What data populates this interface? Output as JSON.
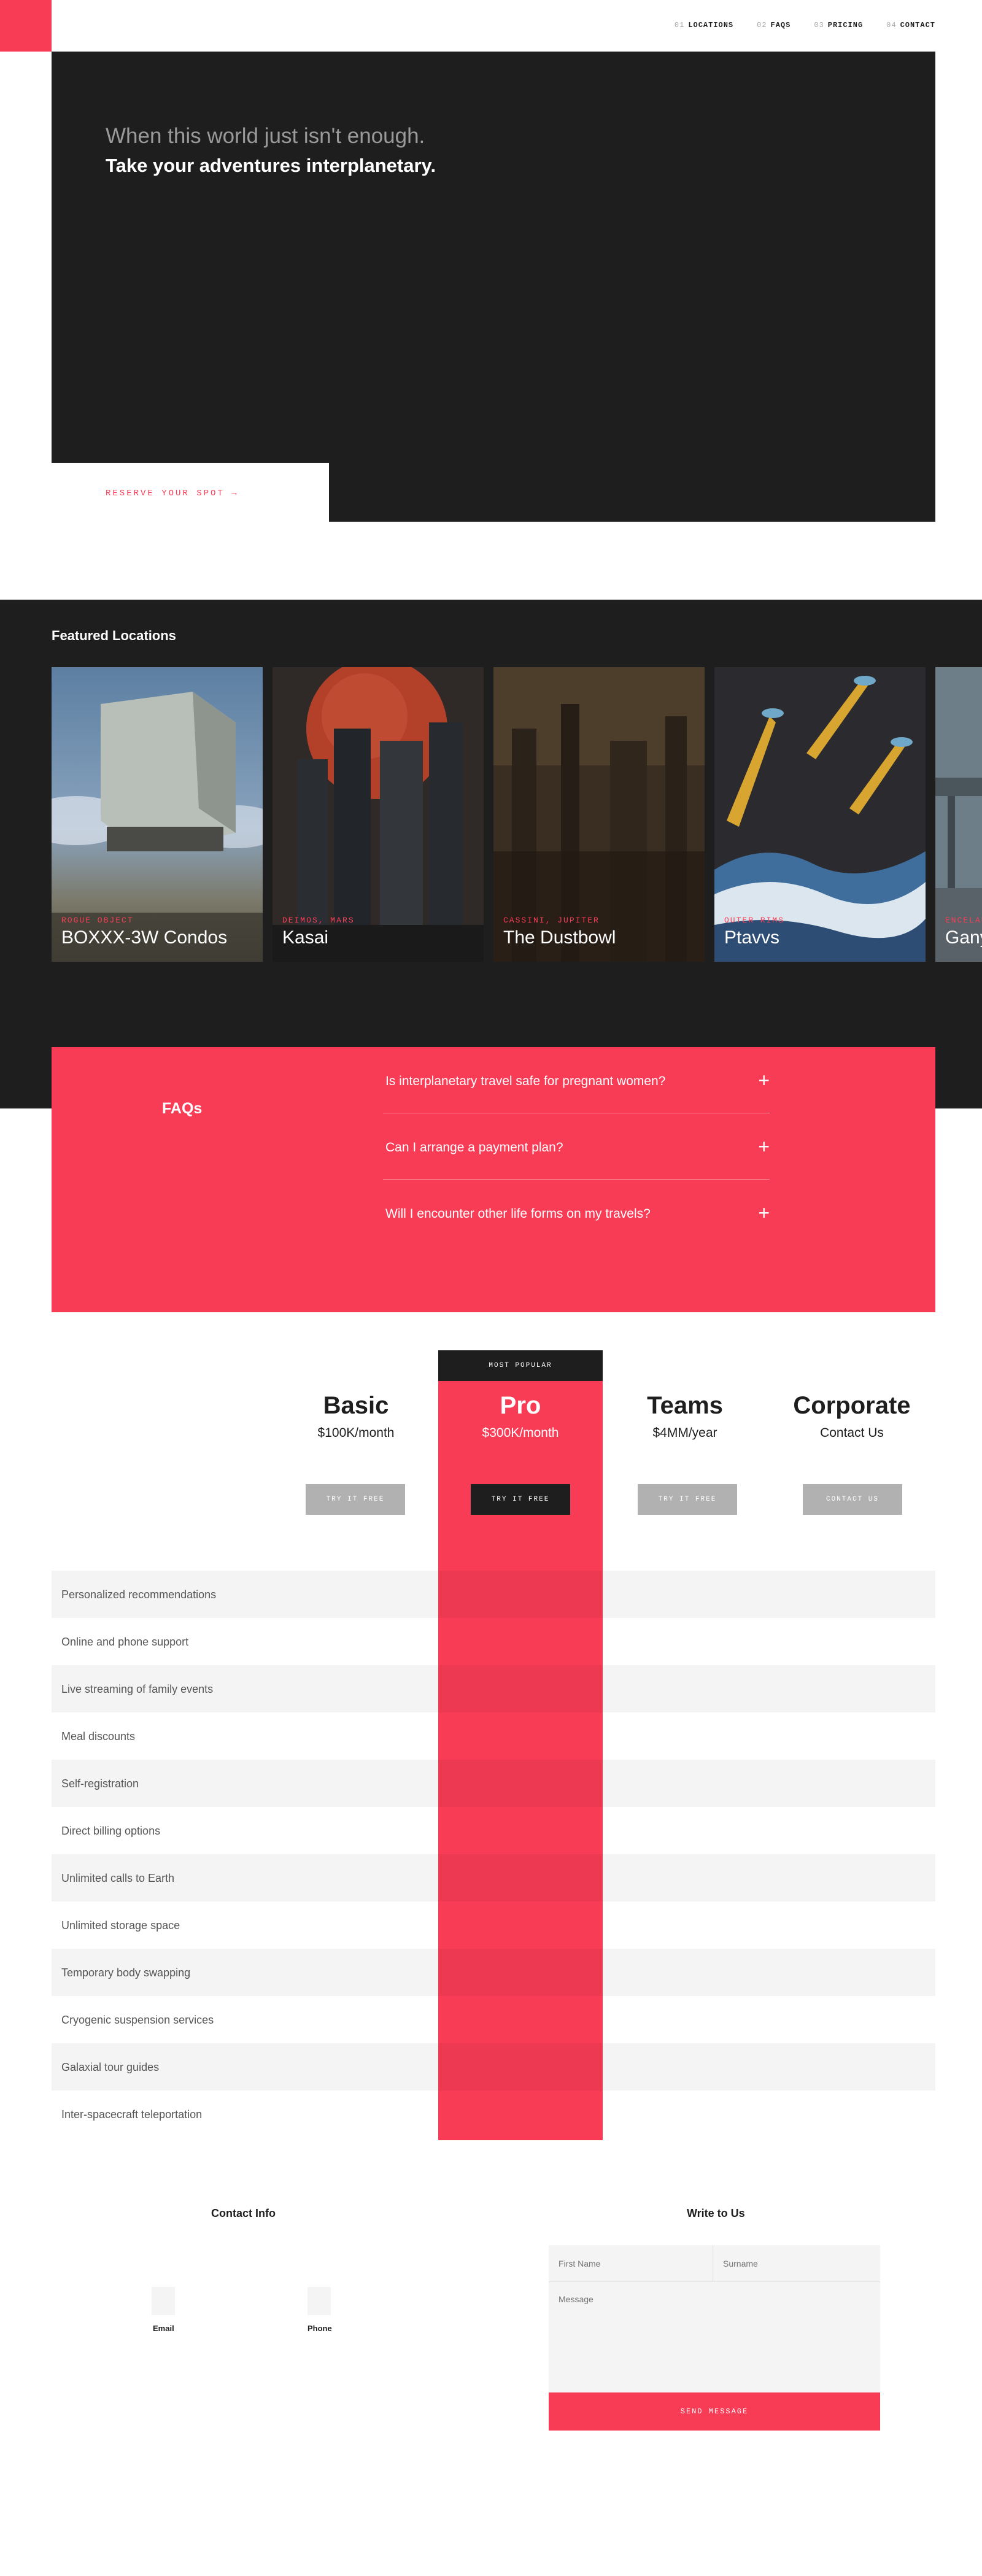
{
  "nav": {
    "items": [
      {
        "num": "01",
        "label": "LOCATIONS"
      },
      {
        "num": "02",
        "label": "FAQS"
      },
      {
        "num": "03",
        "label": "PRICING"
      },
      {
        "num": "04",
        "label": "CONTACT"
      }
    ]
  },
  "hero": {
    "line1": "When this world just isn't enough.",
    "line2": "Take your adventures interplanetary.",
    "cta": "RESERVE YOUR SPOT →"
  },
  "featured": {
    "title": "Featured Locations",
    "cards": [
      {
        "sub": "ROGUE OBJECT",
        "name": "BOXXX-3W Condos"
      },
      {
        "sub": "DEIMOS, MARS",
        "name": "Kasai"
      },
      {
        "sub": "CASSINI, JUPITER",
        "name": "The Dustbowl"
      },
      {
        "sub": "OUTER RIMS",
        "name": "Ptavvs"
      },
      {
        "sub": "ENCELADUS",
        "name": "Ganymede"
      }
    ]
  },
  "faq": {
    "title": "FAQs",
    "items": [
      {
        "q": "Is interplanetary travel safe for pregnant women?",
        "icon": "+"
      },
      {
        "q": "Can I arrange a payment plan?",
        "icon": "+"
      },
      {
        "q": "Will I encounter other life forms on my travels?",
        "icon": "+"
      }
    ]
  },
  "pricing": {
    "most_popular": "MOST POPULAR",
    "plans": [
      {
        "name": "Basic",
        "price": "$100K/month",
        "button": "TRY IT FREE"
      },
      {
        "name": "Pro",
        "price": "$300K/month",
        "button": "TRY IT FREE"
      },
      {
        "name": "Teams",
        "price": "$4MM/year",
        "button": "TRY IT FREE"
      },
      {
        "name": "Corporate",
        "price": "Contact Us",
        "button": "CONTACT US"
      }
    ],
    "features": [
      "Personalized recommendations",
      "Online and phone support",
      "Live streaming of family events",
      "Meal discounts",
      "Self-registration",
      "Direct billing options",
      "Unlimited calls to Earth",
      "Unlimited storage space",
      "Temporary body swapping",
      "Cryogenic suspension services",
      "Galaxial tour guides",
      "Inter-spacecraft teleportation"
    ]
  },
  "contact": {
    "info_title": "Contact Info",
    "email_label": "Email",
    "phone_label": "Phone",
    "form_title": "Write to Us",
    "first_name_ph": "First Name",
    "surname_ph": "Surname",
    "message_ph": "Message",
    "send_label": "SEND MESSAGE"
  },
  "colors": {
    "accent": "#f93c56",
    "dark": "#1e1e1e",
    "muted_button": "#b1b1b1"
  }
}
